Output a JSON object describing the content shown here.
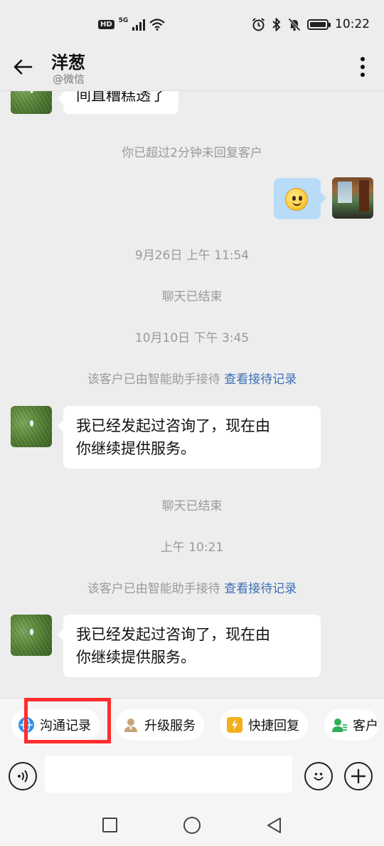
{
  "status_bar": {
    "hd": "HD",
    "network": "5G",
    "time": "10:22",
    "icons": [
      "hd-icon",
      "signal-icon",
      "wifi-icon",
      "alarm-icon",
      "bluetooth-icon",
      "mute-bell-icon",
      "battery-icon"
    ],
    "battery_level": 0.85
  },
  "header": {
    "title": "洋葱",
    "subtitle": "@微信",
    "back_icon": "arrow-left-icon",
    "menu_icon": "more-vertical-icon"
  },
  "messages": {
    "first_partial_text": "间直糟糕透了",
    "notice_timeout": "你已超过2分钟未回复客户",
    "sent_sticker": "smile-emoji",
    "time_1": "9月26日  上午 11:54",
    "chat_ended_1": "聊天已结束",
    "time_2": "10月10日  下午 3:45",
    "assist_1_text": "该客户已由智能助手接待",
    "assist_1_link": "查看接待记录",
    "msg_1": [
      "我已经发起过咨询了，现在由",
      "你继续提供服务。"
    ],
    "chat_ended_2": "聊天已结束",
    "time_3": "上午 10:21",
    "assist_2_text": "该客户已由智能助手接待",
    "assist_2_link": "查看接待记录",
    "msg_2": [
      "我已经发起过咨询了，现在由",
      "你继续提供服务。"
    ]
  },
  "tools": {
    "items": [
      {
        "label": "沟通记录",
        "icon": "globe-icon",
        "color": "#2f8fe6"
      },
      {
        "label": "升级服务",
        "icon": "agent-icon",
        "color": "#c9a27a"
      },
      {
        "label": "快捷回复",
        "icon": "lightning-note-icon",
        "color": "#f2b01e"
      },
      {
        "label": "客户",
        "icon": "customer-icon",
        "color": "#2eae5a"
      }
    ],
    "highlight_color": "#ff2d2d"
  },
  "input": {
    "placeholder": "",
    "value": ""
  },
  "navbar": {
    "icons": [
      "recent-apps-icon",
      "home-icon",
      "back-triangle-icon"
    ]
  }
}
